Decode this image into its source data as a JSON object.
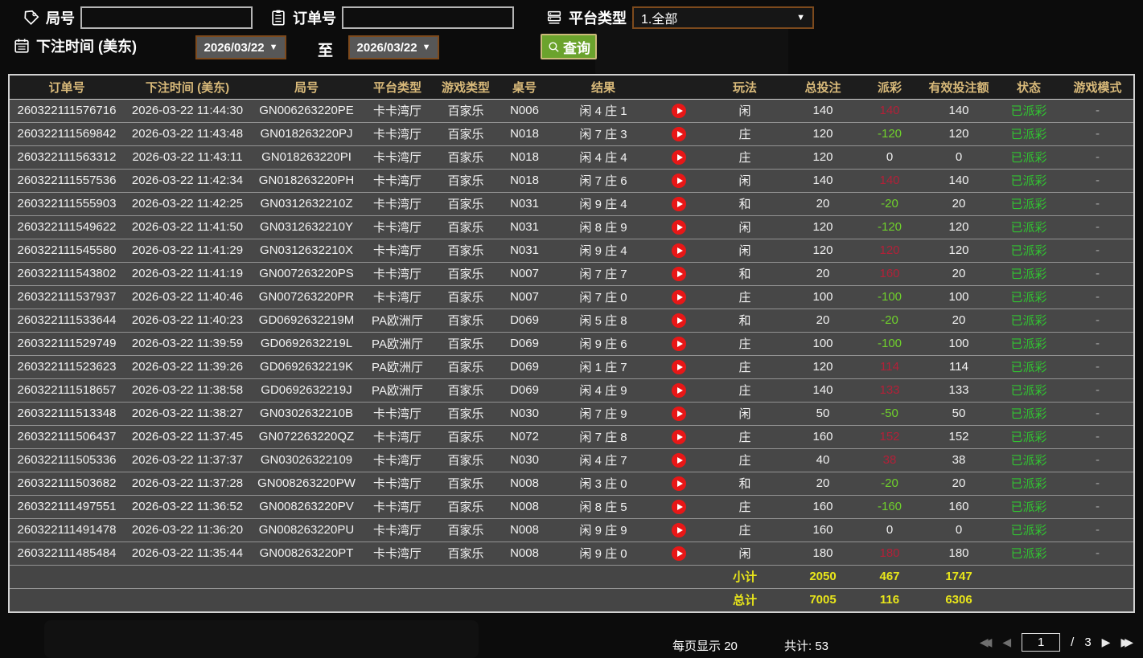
{
  "filters": {
    "round_label": "局号",
    "round_value": "",
    "order_label": "订单号",
    "order_value": "",
    "platform_label": "平台类型",
    "platform_selected": "1.全部",
    "bet_time_label": "下注时间 (美东)",
    "date_from": "2026/03/22",
    "date_to": "2026/03/22",
    "to_label": "至",
    "query_label": "查询"
  },
  "icons": {
    "round": "tag-icon",
    "order": "clipboard-icon",
    "platform": "list-icon",
    "bet_time": "calendar-icon",
    "query": "search-icon",
    "row_media": "play-icon"
  },
  "table": {
    "columns": [
      {
        "id": "order_no",
        "label": "订单号"
      },
      {
        "id": "bet_time",
        "label": "下注时间 (美东)"
      },
      {
        "id": "round_no",
        "label": "局号"
      },
      {
        "id": "platform",
        "label": "平台类型"
      },
      {
        "id": "game_type",
        "label": "游戏类型"
      },
      {
        "id": "table_no",
        "label": "桌号"
      },
      {
        "id": "result",
        "label": "结果"
      },
      {
        "id": "play",
        "label": ""
      },
      {
        "id": "play_type",
        "label": "玩法"
      },
      {
        "id": "total_bet",
        "label": "总投注"
      },
      {
        "id": "payout",
        "label": "派彩"
      },
      {
        "id": "valid_bet",
        "label": "有效投注额"
      },
      {
        "id": "status",
        "label": "状态"
      },
      {
        "id": "game_mode",
        "label": "游戏模式"
      }
    ],
    "rows": [
      {
        "order_no": "260322111576716",
        "bet_time": "2026-03-22 11:44:30",
        "round_no": "GN006263220PE",
        "platform": "卡卡湾厅",
        "game_type": "百家乐",
        "table_no": "N006",
        "result": "闲 4 庄 1",
        "play_type": "闲",
        "total_bet": "140",
        "payout": "140",
        "valid_bet": "140",
        "status": "已派彩",
        "game_mode": "-"
      },
      {
        "order_no": "260322111569842",
        "bet_time": "2026-03-22 11:43:48",
        "round_no": "GN018263220PJ",
        "platform": "卡卡湾厅",
        "game_type": "百家乐",
        "table_no": "N018",
        "result": "闲 7 庄 3",
        "play_type": "庄",
        "total_bet": "120",
        "payout": "-120",
        "valid_bet": "120",
        "status": "已派彩",
        "game_mode": "-"
      },
      {
        "order_no": "260322111563312",
        "bet_time": "2026-03-22 11:43:11",
        "round_no": "GN018263220PI",
        "platform": "卡卡湾厅",
        "game_type": "百家乐",
        "table_no": "N018",
        "result": "闲 4 庄 4",
        "play_type": "庄",
        "total_bet": "120",
        "payout": "0",
        "valid_bet": "0",
        "status": "已派彩",
        "game_mode": "-"
      },
      {
        "order_no": "260322111557536",
        "bet_time": "2026-03-22 11:42:34",
        "round_no": "GN018263220PH",
        "platform": "卡卡湾厅",
        "game_type": "百家乐",
        "table_no": "N018",
        "result": "闲 7 庄 6",
        "play_type": "闲",
        "total_bet": "140",
        "payout": "140",
        "valid_bet": "140",
        "status": "已派彩",
        "game_mode": "-"
      },
      {
        "order_no": "260322111555903",
        "bet_time": "2026-03-22 11:42:25",
        "round_no": "GN0312632210Z",
        "platform": "卡卡湾厅",
        "game_type": "百家乐",
        "table_no": "N031",
        "result": "闲 9 庄 4",
        "play_type": "和",
        "total_bet": "20",
        "payout": "-20",
        "valid_bet": "20",
        "status": "已派彩",
        "game_mode": "-"
      },
      {
        "order_no": "260322111549622",
        "bet_time": "2026-03-22 11:41:50",
        "round_no": "GN0312632210Y",
        "platform": "卡卡湾厅",
        "game_type": "百家乐",
        "table_no": "N031",
        "result": "闲 8 庄 9",
        "play_type": "闲",
        "total_bet": "120",
        "payout": "-120",
        "valid_bet": "120",
        "status": "已派彩",
        "game_mode": "-"
      },
      {
        "order_no": "260322111545580",
        "bet_time": "2026-03-22 11:41:29",
        "round_no": "GN0312632210X",
        "platform": "卡卡湾厅",
        "game_type": "百家乐",
        "table_no": "N031",
        "result": "闲 9 庄 4",
        "play_type": "闲",
        "total_bet": "120",
        "payout": "120",
        "valid_bet": "120",
        "status": "已派彩",
        "game_mode": "-"
      },
      {
        "order_no": "260322111543802",
        "bet_time": "2026-03-22 11:41:19",
        "round_no": "GN007263220PS",
        "platform": "卡卡湾厅",
        "game_type": "百家乐",
        "table_no": "N007",
        "result": "闲 7 庄 7",
        "play_type": "和",
        "total_bet": "20",
        "payout": "160",
        "valid_bet": "20",
        "status": "已派彩",
        "game_mode": "-"
      },
      {
        "order_no": "260322111537937",
        "bet_time": "2026-03-22 11:40:46",
        "round_no": "GN007263220PR",
        "platform": "卡卡湾厅",
        "game_type": "百家乐",
        "table_no": "N007",
        "result": "闲 7 庄 0",
        "play_type": "庄",
        "total_bet": "100",
        "payout": "-100",
        "valid_bet": "100",
        "status": "已派彩",
        "game_mode": "-"
      },
      {
        "order_no": "260322111533644",
        "bet_time": "2026-03-22 11:40:23",
        "round_no": "GD0692632219M",
        "platform": "PA欧洲厅",
        "game_type": "百家乐",
        "table_no": "D069",
        "result": "闲 5 庄 8",
        "play_type": "和",
        "total_bet": "20",
        "payout": "-20",
        "valid_bet": "20",
        "status": "已派彩",
        "game_mode": "-"
      },
      {
        "order_no": "260322111529749",
        "bet_time": "2026-03-22 11:39:59",
        "round_no": "GD0692632219L",
        "platform": "PA欧洲厅",
        "game_type": "百家乐",
        "table_no": "D069",
        "result": "闲 9 庄 6",
        "play_type": "庄",
        "total_bet": "100",
        "payout": "-100",
        "valid_bet": "100",
        "status": "已派彩",
        "game_mode": "-"
      },
      {
        "order_no": "260322111523623",
        "bet_time": "2026-03-22 11:39:26",
        "round_no": "GD0692632219K",
        "platform": "PA欧洲厅",
        "game_type": "百家乐",
        "table_no": "D069",
        "result": "闲 1 庄 7",
        "play_type": "庄",
        "total_bet": "120",
        "payout": "114",
        "valid_bet": "114",
        "status": "已派彩",
        "game_mode": "-"
      },
      {
        "order_no": "260322111518657",
        "bet_time": "2026-03-22 11:38:58",
        "round_no": "GD0692632219J",
        "platform": "PA欧洲厅",
        "game_type": "百家乐",
        "table_no": "D069",
        "result": "闲 4 庄 9",
        "play_type": "庄",
        "total_bet": "140",
        "payout": "133",
        "valid_bet": "133",
        "status": "已派彩",
        "game_mode": "-"
      },
      {
        "order_no": "260322111513348",
        "bet_time": "2026-03-22 11:38:27",
        "round_no": "GN0302632210B",
        "platform": "卡卡湾厅",
        "game_type": "百家乐",
        "table_no": "N030",
        "result": "闲 7 庄 9",
        "play_type": "闲",
        "total_bet": "50",
        "payout": "-50",
        "valid_bet": "50",
        "status": "已派彩",
        "game_mode": "-"
      },
      {
        "order_no": "260322111506437",
        "bet_time": "2026-03-22 11:37:45",
        "round_no": "GN072263220QZ",
        "platform": "卡卡湾厅",
        "game_type": "百家乐",
        "table_no": "N072",
        "result": "闲 7 庄 8",
        "play_type": "庄",
        "total_bet": "160",
        "payout": "152",
        "valid_bet": "152",
        "status": "已派彩",
        "game_mode": "-"
      },
      {
        "order_no": "260322111505336",
        "bet_time": "2026-03-22 11:37:37",
        "round_no": "GN03026322109",
        "platform": "卡卡湾厅",
        "game_type": "百家乐",
        "table_no": "N030",
        "result": "闲 4 庄 7",
        "play_type": "庄",
        "total_bet": "40",
        "payout": "38",
        "valid_bet": "38",
        "status": "已派彩",
        "game_mode": "-"
      },
      {
        "order_no": "260322111503682",
        "bet_time": "2026-03-22 11:37:28",
        "round_no": "GN008263220PW",
        "platform": "卡卡湾厅",
        "game_type": "百家乐",
        "table_no": "N008",
        "result": "闲 3 庄 0",
        "play_type": "和",
        "total_bet": "20",
        "payout": "-20",
        "valid_bet": "20",
        "status": "已派彩",
        "game_mode": "-"
      },
      {
        "order_no": "260322111497551",
        "bet_time": "2026-03-22 11:36:52",
        "round_no": "GN008263220PV",
        "platform": "卡卡湾厅",
        "game_type": "百家乐",
        "table_no": "N008",
        "result": "闲 8 庄 5",
        "play_type": "庄",
        "total_bet": "160",
        "payout": "-160",
        "valid_bet": "160",
        "status": "已派彩",
        "game_mode": "-"
      },
      {
        "order_no": "260322111491478",
        "bet_time": "2026-03-22 11:36:20",
        "round_no": "GN008263220PU",
        "platform": "卡卡湾厅",
        "game_type": "百家乐",
        "table_no": "N008",
        "result": "闲 9 庄 9",
        "play_type": "庄",
        "total_bet": "160",
        "payout": "0",
        "valid_bet": "0",
        "status": "已派彩",
        "game_mode": "-"
      },
      {
        "order_no": "260322111485484",
        "bet_time": "2026-03-22 11:35:44",
        "round_no": "GN008263220PT",
        "platform": "卡卡湾厅",
        "game_type": "百家乐",
        "table_no": "N008",
        "result": "闲 9 庄 0",
        "play_type": "闲",
        "total_bet": "180",
        "payout": "180",
        "valid_bet": "180",
        "status": "已派彩",
        "game_mode": "-"
      }
    ],
    "subtotal": {
      "label": "小计",
      "total_bet": "2050",
      "payout": "467",
      "valid_bet": "1747"
    },
    "total": {
      "label": "总计",
      "total_bet": "7005",
      "payout": "116",
      "valid_bet": "6306"
    }
  },
  "footer": {
    "per_page_label": "每页显示",
    "per_page_value": "20",
    "grand_total_label": "共计:",
    "grand_total_value": "53",
    "current_page": "1",
    "page_sep": "/",
    "page_count": "3"
  },
  "colors": {
    "header_text_gold": "#d9ba7a",
    "payout_positive_red": "#b32038",
    "payout_negative_green": "#6fd02c",
    "status_green": "#31c431",
    "totals_yellow": "#e9e61a",
    "query_button_green": "#6ba32d",
    "query_button_border": "#cbba7a",
    "date_select_border": "#7d4a1d",
    "date_select_bg": "#575757",
    "row_bg": "#474747",
    "play_icon_red": "#e81717"
  }
}
